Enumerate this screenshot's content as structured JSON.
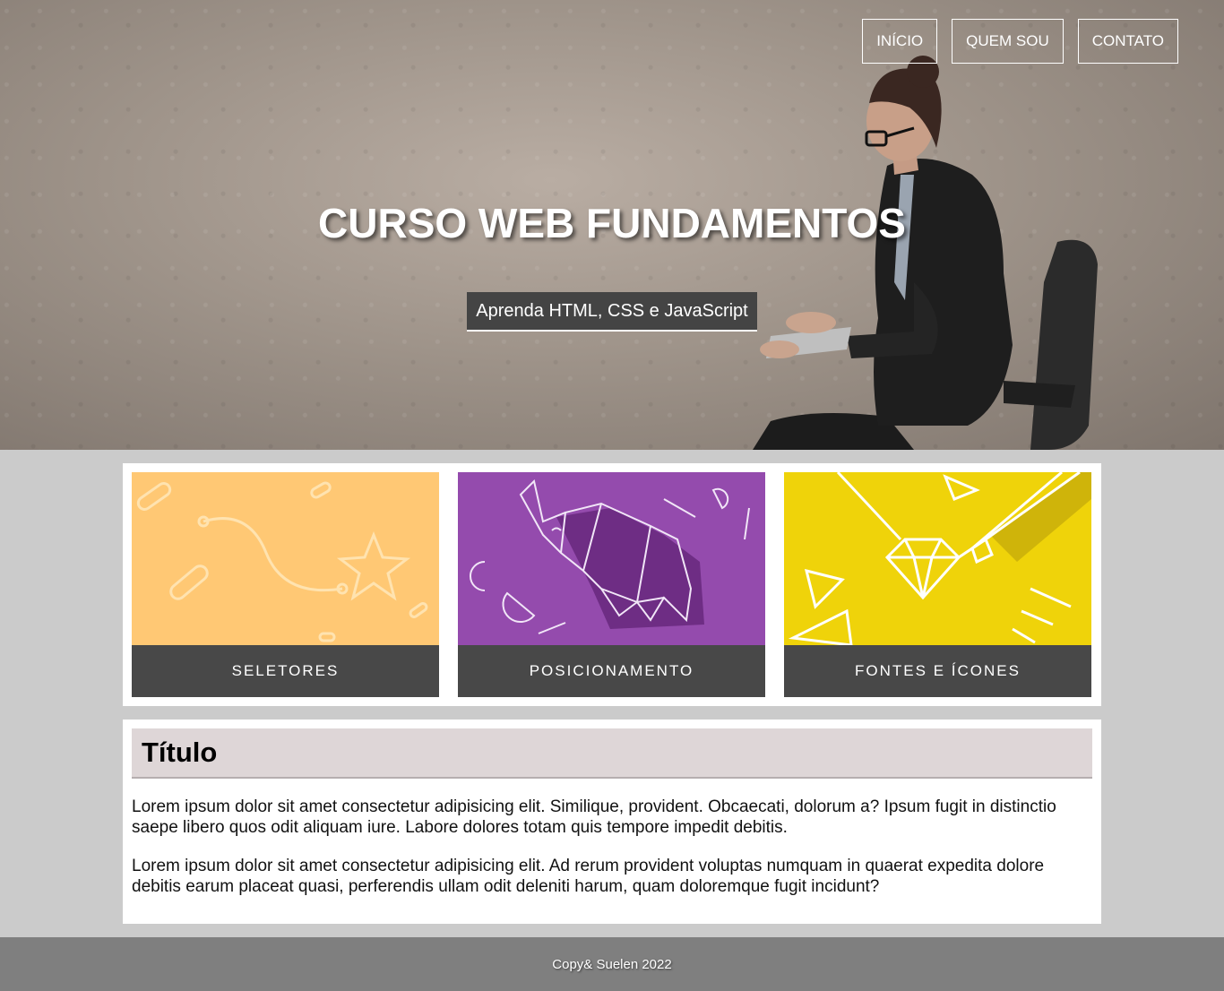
{
  "nav": {
    "items": [
      {
        "label": "INÍCIO"
      },
      {
        "label": "QUEM SOU"
      },
      {
        "label": "CONTATO"
      }
    ]
  },
  "hero": {
    "title": "CURSO WEB FUNDAMENTOS",
    "subtitle": "Aprenda HTML, CSS e JavaScript"
  },
  "cards": [
    {
      "label": "SELETORES",
      "color": "#ffc874",
      "icon": "star-path-icon"
    },
    {
      "label": "POSICIONAMENTO",
      "color": "#944bad",
      "icon": "origami-elephant-icon"
    },
    {
      "label": "FONTES E ÍCONES",
      "color": "#efd30a",
      "icon": "diamond-pencil-icon"
    }
  ],
  "article": {
    "title": "Título",
    "paragraphs": [
      "Lorem ipsum dolor sit amet consectetur adipisicing elit. Similique, provident. Obcaecati, dolorum a? Ipsum fugit in distinctio saepe libero quos odit aliquam iure. Labore dolores totam quis tempore impedit debitis.",
      "Lorem ipsum dolor sit amet consectetur adipisicing elit. Ad rerum provident voluptas numquam in quaerat expedita dolore debitis earum placeat quasi, perferendis ullam odit deleniti harum, quam doloremque fugit incidunt?"
    ]
  },
  "footer": {
    "text": "Copy& Suelen 2022"
  }
}
